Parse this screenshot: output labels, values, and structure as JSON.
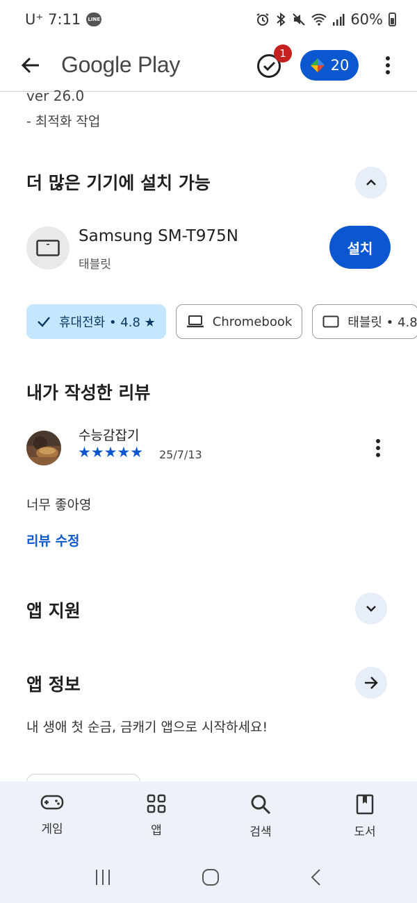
{
  "status_bar": {
    "carrier": "U⁺ 7:11",
    "line_badge": "LINE",
    "battery": "60%",
    "icons": [
      "alarm-icon",
      "bluetooth-icon",
      "mute-icon",
      "wifi-icon",
      "signal-icon",
      "battery-icon"
    ]
  },
  "app_bar": {
    "title": "Google Play",
    "task_badge": "1",
    "points": "20"
  },
  "whats_new": {
    "version": "ver 26.0",
    "note": "- 최적화 작업"
  },
  "devices_section": {
    "title": "더 많은 기기에 설치 가능",
    "device_name": "Samsung SM-T975N",
    "device_type": "태블릿",
    "install_label": "설치",
    "chips": [
      {
        "label": "휴대전화 • 4.8 ★",
        "selected": true
      },
      {
        "label": "Chromebook",
        "selected": false
      },
      {
        "label": "태블릿 • 4.8",
        "selected": false
      }
    ]
  },
  "my_review": {
    "title": "내가 작성한 리뷰",
    "reviewer": "수능감잡기",
    "stars": "★★★★★",
    "rating": 5,
    "date": "25/7/13",
    "text": "너무 좋아영",
    "edit_label": "리뷰 수정"
  },
  "app_support": {
    "title": "앱 지원"
  },
  "app_info": {
    "title": "앱 정보",
    "description": "내 생애 첫 순금, 금캐기 앱으로 시작하세요!"
  },
  "bottom_nav": [
    {
      "label": "게임",
      "icon": "gamepad-icon"
    },
    {
      "label": "앱",
      "icon": "apps-icon"
    },
    {
      "label": "검색",
      "icon": "search-icon"
    },
    {
      "label": "도서",
      "icon": "book-icon"
    }
  ],
  "colors": {
    "accent": "#0b57d0",
    "chip_selected": "#c2e7ff",
    "nav_bg": "#edf2fa",
    "badge": "#c5221f"
  }
}
